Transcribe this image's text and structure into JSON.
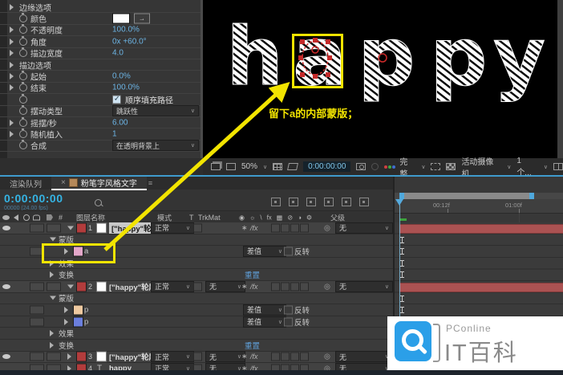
{
  "effect_panel": {
    "rows": [
      {
        "expander": true,
        "stopwatch": false,
        "group": true,
        "label": "边缘选项",
        "value": null
      },
      {
        "expander": false,
        "stopwatch": true,
        "label": "颜色",
        "value": {
          "type": "color"
        }
      },
      {
        "expander": true,
        "stopwatch": true,
        "label": "不透明度",
        "value": {
          "type": "text",
          "text": "100.0%"
        }
      },
      {
        "expander": true,
        "stopwatch": true,
        "label": "角度",
        "value": {
          "type": "text",
          "text": "0x +60.0°"
        }
      },
      {
        "expander": true,
        "stopwatch": true,
        "label": "描边宽度",
        "value": {
          "type": "text",
          "text": "4.0"
        }
      },
      {
        "expander": true,
        "stopwatch": false,
        "group": true,
        "label": "描边选项",
        "value": null
      },
      {
        "expander": true,
        "stopwatch": true,
        "label": "起始",
        "value": {
          "type": "text",
          "text": "0.0%"
        }
      },
      {
        "expander": true,
        "stopwatch": true,
        "label": "结束",
        "value": {
          "type": "text",
          "text": "100.0%"
        }
      },
      {
        "expander": false,
        "stopwatch": true,
        "label": "",
        "value": {
          "type": "check",
          "text": "顺序填充路径",
          "checked": true
        }
      },
      {
        "expander": false,
        "stopwatch": true,
        "label": "摆动类型",
        "value": {
          "type": "dropdown",
          "text": "跳跃性"
        }
      },
      {
        "expander": true,
        "stopwatch": true,
        "label": "摇摆/秒",
        "value": {
          "type": "text",
          "text": "6.00"
        }
      },
      {
        "expander": true,
        "stopwatch": true,
        "label": "随机植入",
        "value": {
          "type": "text",
          "text": "1"
        }
      },
      {
        "expander": false,
        "stopwatch": true,
        "label": "合成",
        "value": {
          "type": "dropdown",
          "text": "在透明背景上"
        }
      }
    ]
  },
  "viewer": {
    "text": "happy",
    "letters": [
      "h",
      "a",
      "p",
      "p",
      "y"
    ],
    "annotation": "留下a的内部蒙版；",
    "annotation_color": "#f2e400",
    "mask_color": "#cc2a2a"
  },
  "viewer_toolbar": {
    "zoom": "50%",
    "timecode": "0:00:00:00",
    "resolution": "完整",
    "camera": "活动摄像机",
    "views": "1 个..."
  },
  "timeline": {
    "tabs": [
      {
        "label": "渲染队列",
        "active": false
      },
      {
        "label": "粉笔字风格文字",
        "active": true
      }
    ],
    "timecode": "0:00:00:00",
    "framerate": "00000 (24.00 fps)",
    "columns": {
      "layer_name": "图层名称",
      "mode": "模式",
      "t": "T",
      "trkmat": "TrkMat",
      "parent": "父级"
    },
    "switch_icons": [
      "◉",
      "☼",
      "\\",
      "fx",
      "▦",
      "⊘",
      "◑",
      "⚙"
    ],
    "label_color": "#b23c3c",
    "ruler": {
      "t1": "00:12f",
      "t2": "01:00f"
    },
    "rows": [
      {
        "type": "layer",
        "eye": true,
        "expanded": true,
        "num": "1",
        "name": "[\"happy\"轮廓]",
        "selected": true,
        "mode": "正常",
        "trkmat": null,
        "parent": "无",
        "bar": true,
        "beam": false
      },
      {
        "type": "group",
        "expanded": true,
        "label": "蒙版",
        "beam": true
      },
      {
        "type": "mask",
        "color": "#e3a7c9",
        "label": "a",
        "mode": "差值",
        "invert": "反转",
        "highlight": true,
        "beam": true
      },
      {
        "type": "group",
        "expanded": false,
        "label": "效果",
        "beam": true
      },
      {
        "type": "group",
        "expanded": false,
        "label": "变换",
        "reset": "重置",
        "beam": true
      },
      {
        "type": "layer",
        "eye": true,
        "expanded": true,
        "num": "2",
        "name": "[\"happy\"轮廓]",
        "selected": false,
        "mode": "正常",
        "trkmat": "无",
        "parent": "无",
        "bar": true,
        "beam": false
      },
      {
        "type": "group",
        "expanded": true,
        "label": "蒙版",
        "beam": true
      },
      {
        "type": "mask",
        "color": "#eec9a0",
        "label": "p",
        "mode": "差值",
        "invert": "反转",
        "beam": true
      },
      {
        "type": "mask",
        "color": "#6b7fdd",
        "label": "p",
        "mode": "差值",
        "invert": "反转",
        "beam": true
      },
      {
        "type": "group",
        "expanded": false,
        "label": "效果",
        "beam": false
      },
      {
        "type": "group",
        "expanded": false,
        "label": "变换",
        "reset": "重置",
        "beam": false
      },
      {
        "type": "layer",
        "eye": true,
        "expanded": false,
        "num": "3",
        "name": "[\"happy\"轮廓]",
        "selected": false,
        "mode": "正常",
        "trkmat": "无",
        "parent": "无",
        "bar": false,
        "beam": false
      },
      {
        "type": "layer",
        "eye": false,
        "expanded": false,
        "num": "4",
        "name": "happy",
        "textLayer": true,
        "selected": false,
        "mode": "正常",
        "trkmat": "无",
        "parent": "无",
        "bar": false,
        "beam": false
      }
    ]
  },
  "watermark": {
    "brand": "PConline",
    "title": "IT百科",
    "logo_color": "#2b9fe8"
  }
}
